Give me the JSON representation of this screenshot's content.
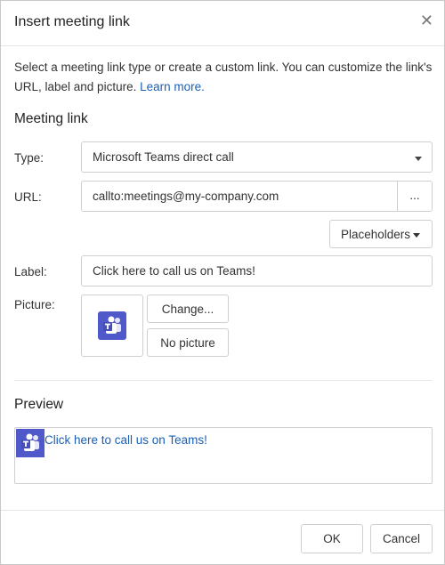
{
  "dialog": {
    "title": "Insert meeting link",
    "close_icon": "close-icon"
  },
  "intro": {
    "text": "Select a meeting link type or create a custom link. You can customize the link's URL, label and picture.",
    "learn_more": "Learn more."
  },
  "meeting_link": {
    "section_title": "Meeting link",
    "type_label": "Type:",
    "type_value": "Microsoft Teams direct call",
    "url_label": "URL:",
    "url_value": "callto:meetings@my-company.com",
    "url_more_button": "...",
    "placeholders_button": "Placeholders",
    "label_label": "Label:",
    "label_value": "Click here to call us on Teams!",
    "picture_label": "Picture:",
    "picture_icon": "teams-icon",
    "change_button": "Change...",
    "no_picture_button": "No picture"
  },
  "preview": {
    "section_title": "Preview",
    "link_text": "Click here to call us on Teams!",
    "icon": "teams-icon"
  },
  "footer": {
    "ok_button": "OK",
    "cancel_button": "Cancel"
  },
  "colors": {
    "teams_purple": "#5059c9",
    "link_blue": "#1a5fb4"
  }
}
